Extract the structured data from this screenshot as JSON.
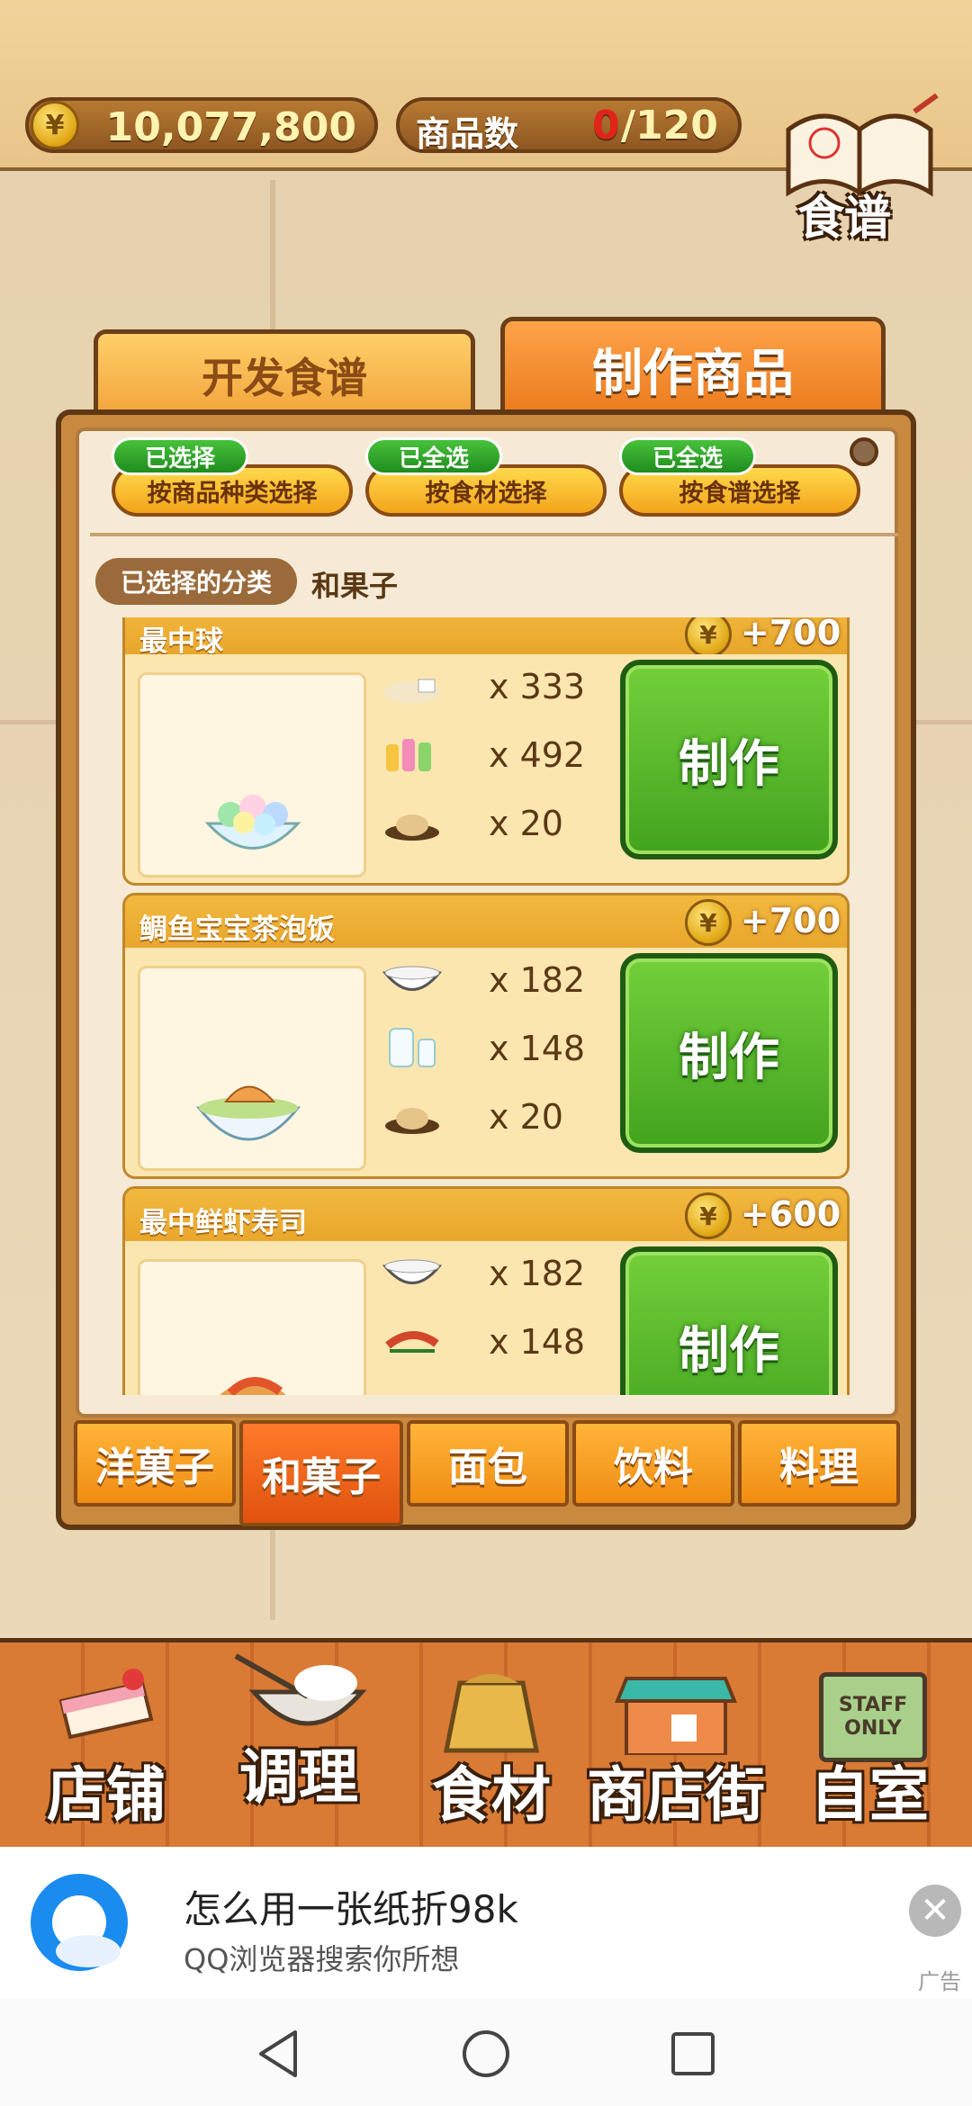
{
  "header": {
    "money": "10,077,800",
    "items_label": "商品数",
    "items_count": "0",
    "items_max": "/120",
    "recipe_book_label": "食谱",
    "coin_symbol": "¥"
  },
  "main_tabs": [
    {
      "label": "开发食谱"
    },
    {
      "label": "制作商品"
    }
  ],
  "filters": [
    {
      "badge": "已选择",
      "label": "按商品种类选择"
    },
    {
      "badge": "已全选",
      "label": "按食材选择"
    },
    {
      "badge": "已全选",
      "label": "按食谱选择"
    }
  ],
  "selected_category": {
    "label": "已选择的分类",
    "value": "和果子"
  },
  "products": [
    {
      "name": "最中球",
      "reward": "+700",
      "ingredients": [
        {
          "icon": "flour-icon",
          "qty": "x 333"
        },
        {
          "icon": "bottles-icon",
          "qty": "x 492"
        },
        {
          "icon": "bean-paste-icon",
          "qty": "x 20"
        }
      ],
      "button": "制作",
      "dish_icon": "dessert-bowl-icon"
    },
    {
      "name": "鲷鱼宝宝茶泡饭",
      "reward": "+700",
      "ingredients": [
        {
          "icon": "rice-bowl-icon",
          "qty": "x 182"
        },
        {
          "icon": "milk-jug-icon",
          "qty": "x 148"
        },
        {
          "icon": "bean-paste-icon",
          "qty": "x 20"
        }
      ],
      "button": "制作",
      "dish_icon": "tea-rice-bowl-icon"
    },
    {
      "name": "最中鲜虾寿司",
      "reward": "+600",
      "ingredients": [
        {
          "icon": "rice-bowl-icon",
          "qty": "x 182"
        },
        {
          "icon": "shrimp-icon",
          "qty": "x 148"
        }
      ],
      "button": "制作",
      "dish_icon": "shrimp-sushi-icon"
    }
  ],
  "category_tabs": [
    {
      "label": "洋菓子",
      "active": false
    },
    {
      "label": "和菓子",
      "active": true
    },
    {
      "label": "面包",
      "active": false
    },
    {
      "label": "饮料",
      "active": false
    },
    {
      "label": "料理",
      "active": false
    }
  ],
  "bottom_nav": [
    {
      "label": "店铺",
      "icon": "cake-icon"
    },
    {
      "label": "调理",
      "icon": "whisk-bowl-icon"
    },
    {
      "label": "食材",
      "icon": "flour-sack-icon"
    },
    {
      "label": "商店街",
      "icon": "shop-icon"
    },
    {
      "label": "自室",
      "icon": "staff-only-sign-icon"
    }
  ],
  "staff_sign": "STAFF ONLY",
  "ad": {
    "title": "怎么用一张纸折98k",
    "subtitle": "QQ浏览器搜索你所想",
    "tag": "广告"
  },
  "colors": {
    "accent_orange": "#f08d12",
    "make_green": "#42a31f",
    "panel_brown": "#5e3714"
  }
}
